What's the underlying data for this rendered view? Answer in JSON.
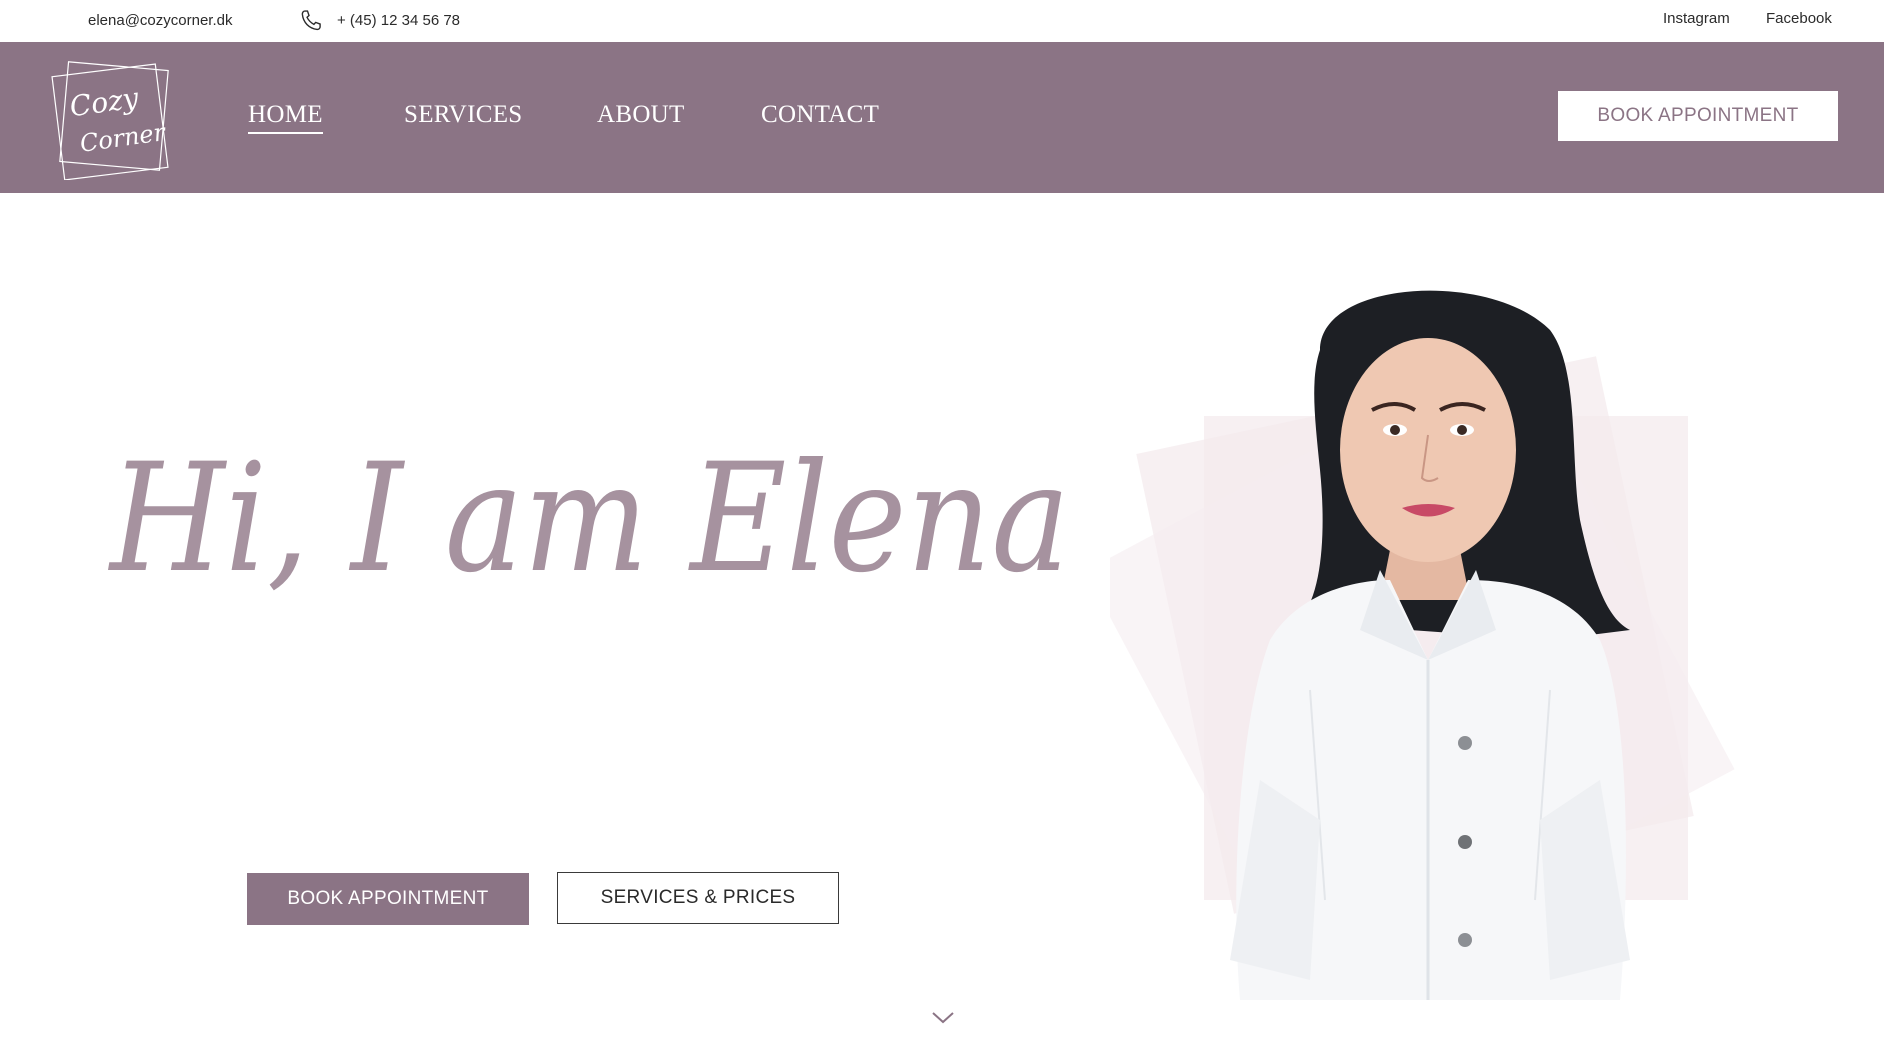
{
  "topbar": {
    "email": "elena@cozycorner.dk",
    "phone": "+ (45) 12 34 56 78",
    "phone_icon": "phone-icon",
    "social": [
      "Instagram",
      "Facebook"
    ]
  },
  "brand": {
    "logo_line1": "Cozy",
    "logo_line2": "Corner"
  },
  "nav": {
    "items": [
      "HOME",
      "SERVICES",
      "ABOUT",
      "CONTACT"
    ],
    "active": "HOME",
    "book_label": "BOOK APPOINTMENT"
  },
  "hero": {
    "heading": "Hi, I am Elena",
    "primary_button": "BOOK APPOINTMENT",
    "secondary_button": "SERVICES & PRICES",
    "scroll_icon": "chevron-down-icon"
  },
  "colors": {
    "accent": "#8b7485",
    "heading": "#a6929f",
    "background": "#ffffff"
  }
}
